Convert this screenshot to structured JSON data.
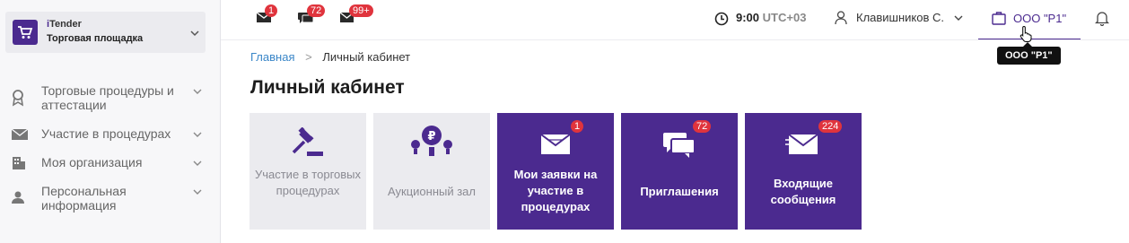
{
  "brand": {
    "name_prefix": "i",
    "name": "Tender",
    "subtitle": "Торговая площадка"
  },
  "sidebar": {
    "items": [
      {
        "label": "Торговые процедуры и аттестации",
        "icon": "award-icon"
      },
      {
        "label": "Участие в процедурах",
        "icon": "envelope-icon"
      },
      {
        "label": "Моя организация",
        "icon": "building-icon"
      },
      {
        "label": "Персональная информация",
        "icon": "person-icon"
      }
    ]
  },
  "topbar": {
    "mail_badge": "1",
    "chat_badge": "72",
    "inbox_badge": "99+",
    "time": "9:00",
    "timezone": "UTC+03",
    "user": "Клавишников С.",
    "org": "ООО \"Р1\"",
    "tooltip": "ООО \"Р1\""
  },
  "breadcrumb": {
    "home": "Главная",
    "current": "Личный кабинет"
  },
  "page_title": "Личный кабинет",
  "tiles": [
    {
      "label": "Участие в торговых процедурах",
      "icon": "gavel-icon",
      "badge": ""
    },
    {
      "label": "Аукционный зал",
      "icon": "auction-hall-icon",
      "badge": ""
    },
    {
      "label": "Мои заявки на участие в процедурах",
      "icon": "envelope-icon",
      "badge": "1"
    },
    {
      "label": "Приглашения",
      "icon": "chat-icon",
      "badge": "72"
    },
    {
      "label": "Входящие сообщения",
      "icon": "inbox-icon",
      "badge": "224"
    }
  ],
  "colors": {
    "accent": "#4b2a8f",
    "badge": "#e0343d",
    "link": "#3a86c8",
    "tile_light": "#ebebef"
  }
}
